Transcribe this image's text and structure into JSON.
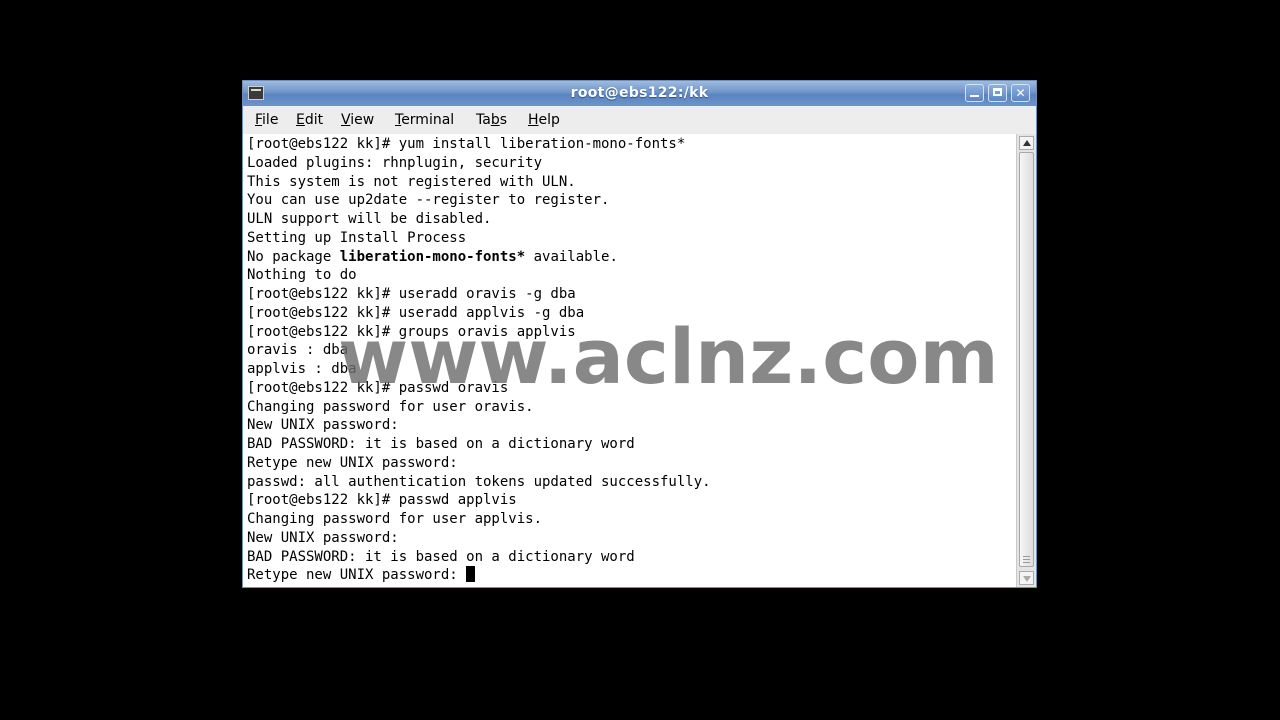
{
  "window": {
    "title": "root@ebs122:/kk"
  },
  "menubar": {
    "items": [
      {
        "label": "File",
        "mnemonic_index": 0
      },
      {
        "label": "Edit",
        "mnemonic_index": 0
      },
      {
        "label": "View",
        "mnemonic_index": 0
      },
      {
        "label": "Terminal",
        "mnemonic_index": 0
      },
      {
        "label": "Tabs",
        "mnemonic_index": 2
      },
      {
        "label": "Help",
        "mnemonic_index": 0
      }
    ]
  },
  "terminal": {
    "lines": [
      {
        "text": "[root@ebs122 kk]# yum install liberation-mono-fonts*"
      },
      {
        "text": "Loaded plugins: rhnplugin, security"
      },
      {
        "text": "This system is not registered with ULN."
      },
      {
        "text": "You can use up2date --register to register."
      },
      {
        "text": "ULN support will be disabled."
      },
      {
        "text": "Setting up Install Process"
      },
      {
        "pre": "No package ",
        "bold": "liberation-mono-fonts*",
        "post": " available."
      },
      {
        "text": "Nothing to do"
      },
      {
        "text": "[root@ebs122 kk]# useradd oravis -g dba"
      },
      {
        "text": "[root@ebs122 kk]# useradd applvis -g dba"
      },
      {
        "text": "[root@ebs122 kk]# groups oravis applvis"
      },
      {
        "text": "oravis : dba"
      },
      {
        "text": "applvis : dba"
      },
      {
        "text": "[root@ebs122 kk]# passwd oravis"
      },
      {
        "text": "Changing password for user oravis."
      },
      {
        "text": "New UNIX password:"
      },
      {
        "text": "BAD PASSWORD: it is based on a dictionary word"
      },
      {
        "text": "Retype new UNIX password:"
      },
      {
        "text": "passwd: all authentication tokens updated successfully."
      },
      {
        "text": "[root@ebs122 kk]# passwd applvis"
      },
      {
        "text": "Changing password for user applvis."
      },
      {
        "text": "New UNIX password:"
      },
      {
        "text": "BAD PASSWORD: it is based on a dictionary word"
      },
      {
        "text": "Retype new UNIX password: ",
        "cursor": true
      }
    ]
  },
  "watermark": {
    "text": "www.aclnz.com"
  }
}
